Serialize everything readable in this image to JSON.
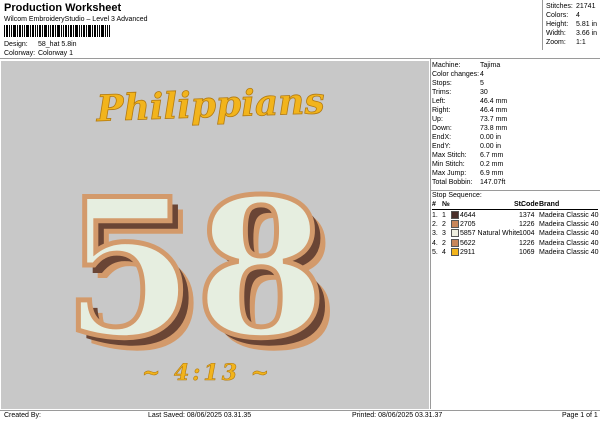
{
  "header": {
    "title": "Production Worksheet",
    "subtitle": "Wilcom EmbroideryStudio – Level 3 Advanced",
    "design_label": "Design:",
    "design_value": "58_hat 5.8in",
    "colorway_label": "Colorway:",
    "colorway_value": "Colorway 1"
  },
  "summary": [
    {
      "label": "Stitches:",
      "value": "21741"
    },
    {
      "label": "Colors:",
      "value": "4"
    },
    {
      "label": "Height:",
      "value": "5.81 in"
    },
    {
      "label": "Width:",
      "value": "3.66 in"
    },
    {
      "label": "Zoom:",
      "value": "1:1"
    }
  ],
  "machine_info": [
    {
      "label": "Machine:",
      "value": "Tajima"
    },
    {
      "label": "Color changes:",
      "value": "4"
    },
    {
      "label": "Stops:",
      "value": "5"
    },
    {
      "label": "Trims:",
      "value": "30"
    },
    {
      "label": "Left:",
      "value": "46.4 mm"
    },
    {
      "label": "Right:",
      "value": "46.4 mm"
    },
    {
      "label": "Up:",
      "value": "73.7 mm"
    },
    {
      "label": "Down:",
      "value": "73.8 mm"
    },
    {
      "label": "EndX:",
      "value": "0.00 in"
    },
    {
      "label": "EndY:",
      "value": "0.00 in"
    },
    {
      "label": "Max Stitch:",
      "value": "6.7 mm"
    },
    {
      "label": "Min Stitch:",
      "value": "0.2 mm"
    },
    {
      "label": "Max Jump:",
      "value": "6.9 mm"
    },
    {
      "label": "Total Bobbin:",
      "value": "147.07ft"
    }
  ],
  "stop_sequence": {
    "title": "Stop Sequence:",
    "columns": {
      "index": "#",
      "number": "№",
      "st": "St.",
      "code": "Code",
      "brand": "Brand"
    },
    "rows": [
      {
        "index": "1.",
        "number": "1",
        "color": "#4a2f2a",
        "name": "4644",
        "st": "1374",
        "code": "",
        "brand": "Madeira Classic 40"
      },
      {
        "index": "2.",
        "number": "2",
        "color": "#c8865a",
        "name": "2705",
        "st": "1226",
        "code": "",
        "brand": "Madeira Classic 40"
      },
      {
        "index": "3.",
        "number": "3",
        "color": "#eeeedf",
        "name": "5857 Natural White",
        "st": "1004",
        "code": "",
        "brand": "Madeira Classic 40"
      },
      {
        "index": "4.",
        "number": "2",
        "color": "#c8865a",
        "name": "5622",
        "st": "1226",
        "code": "",
        "brand": "Madeira Classic 40"
      },
      {
        "index": "5.",
        "number": "4",
        "color": "#f2b41c",
        "name": "2911",
        "st": "1069",
        "code": "",
        "brand": "Madeira Classic 40"
      }
    ]
  },
  "design_art": {
    "top_word": "Philippians",
    "number": "58",
    "bottom_text": "~ 4:13 ~",
    "colors": {
      "gold": "#f2b41c",
      "tan": "#d39a6b",
      "brown": "#6a4535",
      "cream": "#e6eee0",
      "background": "#c8c8c8"
    }
  },
  "footer": {
    "created_by": "Created By:",
    "last_saved": "Last Saved: 08/06/2025 03.31.35",
    "printed": "Printed: 08/06/2025 03.31.37",
    "page": "Page 1 of 1"
  }
}
